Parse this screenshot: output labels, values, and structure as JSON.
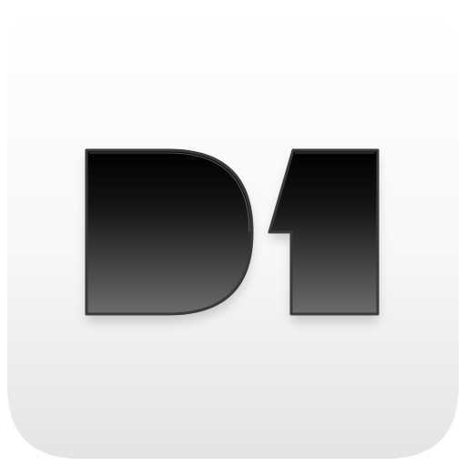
{
  "app_icon": {
    "logo_text": "D1",
    "icon_name": "d1-app-icon",
    "colors": {
      "background_top": "#ffffff",
      "background_bottom": "#e4e4e4",
      "glyph_top": "#000000",
      "glyph_bottom": "#6b6b6b",
      "glyph_stroke": "#3a3a3a"
    }
  }
}
